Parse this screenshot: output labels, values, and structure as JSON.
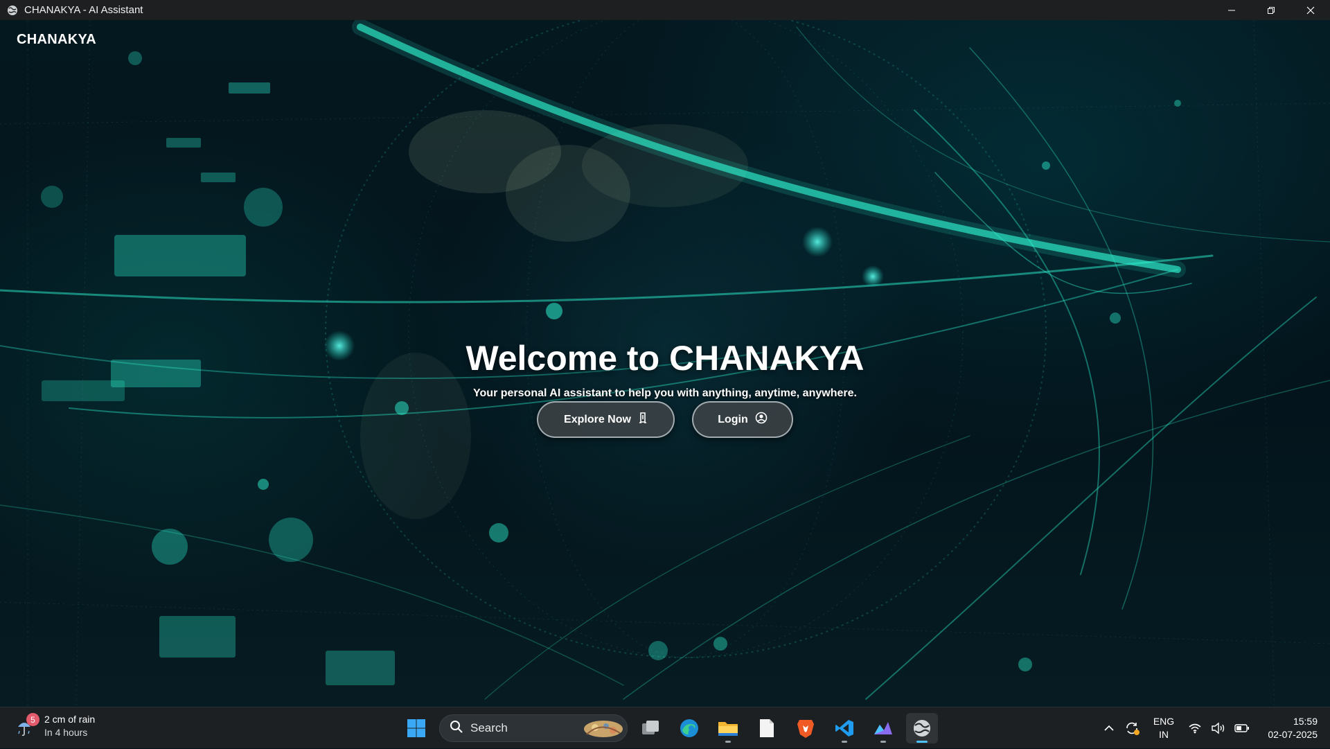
{
  "window": {
    "title": "CHANAKYA - AI Assistant"
  },
  "app": {
    "brand": "CHANAKYA",
    "hero_title": "Welcome to CHANAKYA",
    "hero_subtitle": "Your personal AI assistant to help you with anything, anytime, anywhere.",
    "buttons": {
      "explore_label": "Explore Now",
      "login_label": "Login"
    },
    "background_theme": "cyber-globe",
    "accent_color": "#2ef2d0"
  },
  "taskbar": {
    "weather": {
      "badge": "5",
      "line1": "2 cm of rain",
      "line2": "In 4 hours"
    },
    "search_placeholder": "Search",
    "pinned_icons": [
      "windows-start-icon",
      "task-view-icon",
      "edge-browser-icon",
      "file-explorer-icon",
      "notepad-icon",
      "brave-browser-icon",
      "vscode-icon",
      "app-icon",
      "chanakya-app-icon"
    ],
    "tray": {
      "lang_line1": "ENG",
      "lang_line2": "IN",
      "time": "15:59",
      "date": "02-07-2025"
    }
  }
}
